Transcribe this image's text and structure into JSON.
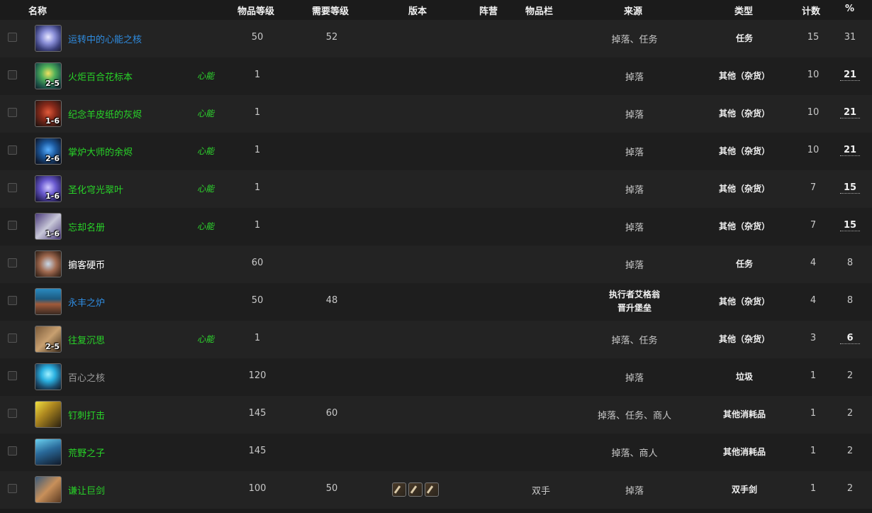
{
  "columns": {
    "name": "名称",
    "item_level": "物品等级",
    "req_level": "需要等级",
    "version": "版本",
    "faction": "阵营",
    "slot": "物品栏",
    "source": "来源",
    "type": "类型",
    "count": "计数",
    "percent": "%"
  },
  "colors": {
    "quality_blue": "#2f8ce0",
    "quality_green": "#28d428",
    "quality_white": "#ffffff",
    "quality_gray": "#9d9d9d"
  },
  "rows": [
    {
      "name": "运转中的心能之核",
      "tag": "",
      "badge": "",
      "ilvl": "50",
      "rlvl": "52",
      "slot": "",
      "source": "掉落、任务",
      "type": "任务",
      "count": "15",
      "pct": "31",
      "icon": "crystal-core-icon",
      "quality": "blue"
    },
    {
      "name": "火炬百合花标本",
      "tag": "心能",
      "badge": "2-5",
      "ilvl": "1",
      "rlvl": "",
      "slot": "",
      "source": "掉落",
      "type": "其他（杂货）",
      "count": "10",
      "pct": "21",
      "icon": "flower-icon",
      "quality": "green"
    },
    {
      "name": "纪念羊皮纸的灰烬",
      "tag": "心能",
      "badge": "1-6",
      "ilvl": "1",
      "rlvl": "",
      "slot": "",
      "source": "掉落",
      "type": "其他（杂货）",
      "count": "10",
      "pct": "21",
      "icon": "ashes-icon",
      "quality": "green"
    },
    {
      "name": "掌炉大师的余烬",
      "tag": "心能",
      "badge": "2-6",
      "ilvl": "1",
      "rlvl": "",
      "slot": "",
      "source": "掉落",
      "type": "其他（杂货）",
      "count": "10",
      "pct": "21",
      "icon": "ember-icon",
      "quality": "green"
    },
    {
      "name": "圣化穹光翠叶",
      "tag": "心能",
      "badge": "1-6",
      "ilvl": "1",
      "rlvl": "",
      "slot": "",
      "source": "掉落",
      "type": "其他（杂货）",
      "count": "7",
      "pct": "15",
      "icon": "leaf-icon",
      "quality": "green"
    },
    {
      "name": "忘却名册",
      "tag": "心能",
      "badge": "1-6",
      "ilvl": "1",
      "rlvl": "",
      "slot": "",
      "source": "掉落",
      "type": "其他（杂货）",
      "count": "7",
      "pct": "15",
      "icon": "scroll-icon",
      "quality": "green"
    },
    {
      "name": "掮客硬币",
      "tag": "",
      "badge": "",
      "ilvl": "60",
      "rlvl": "",
      "slot": "",
      "source": "掉落",
      "type": "任务",
      "count": "4",
      "pct": "8",
      "icon": "coin-icon",
      "quality": "white"
    },
    {
      "name": "永丰之炉",
      "tag": "",
      "badge": "",
      "ilvl": "50",
      "rlvl": "48",
      "slot": "",
      "source": "",
      "source_line1": "执行者艾格翁",
      "source_line2": "晋升堡垒",
      "type": "其他（杂货）",
      "count": "4",
      "pct": "8",
      "icon": "forge-icon",
      "quality": "blue"
    },
    {
      "name": "往复沉思",
      "tag": "心能",
      "badge": "2-5",
      "ilvl": "1",
      "rlvl": "",
      "slot": "",
      "source": "掉落、任务",
      "type": "其他（杂货）",
      "count": "3",
      "pct": "6",
      "icon": "contemplation-icon",
      "quality": "green"
    },
    {
      "name": "百心之核",
      "tag": "",
      "badge": "",
      "ilvl": "120",
      "rlvl": "",
      "slot": "",
      "source": "掉落",
      "type": "垃圾",
      "count": "1",
      "pct": "2",
      "icon": "orb-core-icon",
      "quality": "gray"
    },
    {
      "name": "钉刺打击",
      "tag": "",
      "badge": "",
      "ilvl": "145",
      "rlvl": "60",
      "slot": "",
      "source": "掉落、任务、商人",
      "type": "其他消耗品",
      "count": "1",
      "pct": "2",
      "icon": "spike-strike-icon",
      "quality": "green"
    },
    {
      "name": "荒野之子",
      "tag": "",
      "badge": "",
      "ilvl": "145",
      "rlvl": "",
      "slot": "",
      "source": "掉落、商人",
      "type": "其他消耗品",
      "count": "1",
      "pct": "2",
      "icon": "wild-child-icon",
      "quality": "green"
    },
    {
      "name": "谦让巨剑",
      "tag": "",
      "badge": "",
      "ilvl": "100",
      "rlvl": "50",
      "slot": "双手",
      "source": "掉落",
      "type": "双手剑",
      "count": "1",
      "pct": "2",
      "icon": "greatsword-icon",
      "quality": "green",
      "versions": [
        "sword-version-icon",
        "sword-version-icon",
        "sword-version-icon"
      ]
    }
  ]
}
